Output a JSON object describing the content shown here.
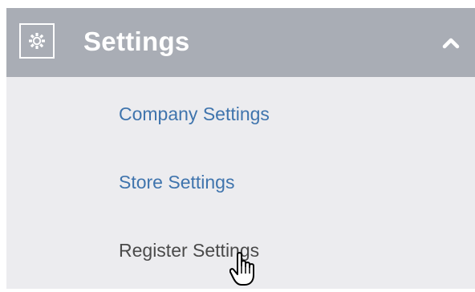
{
  "section": {
    "icon": "gear-icon",
    "title": "Settings",
    "toggle_icon": "chevron-up-icon"
  },
  "items": [
    {
      "label": "Company Settings"
    },
    {
      "label": "Store Settings"
    },
    {
      "label": "Register Settings"
    }
  ],
  "colors": {
    "header_bg": "#a9adb5",
    "panel_bg": "#ececef",
    "link": "#3f74ad",
    "hover_text": "#4a4a4a"
  },
  "cursor": "pointer-hand"
}
